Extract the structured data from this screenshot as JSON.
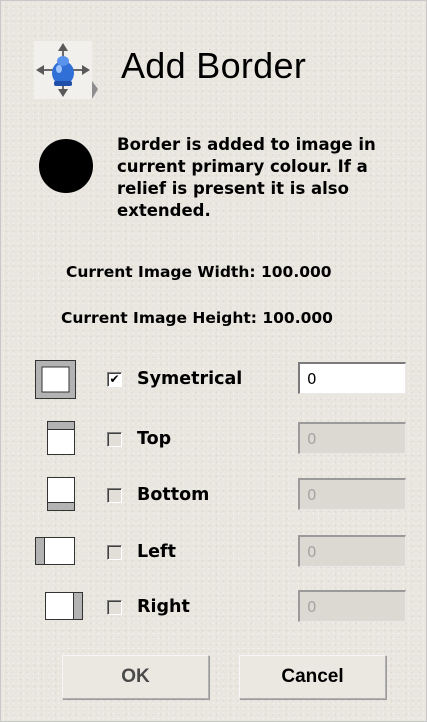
{
  "dialog": {
    "title": "Add Border",
    "app_icon": "move-arrows-icon",
    "primary_colour": "#000000",
    "description": "Border is added to image in current primary colour. If a relief is present it is also extended.",
    "width_text": "Current Image Width: 100.000",
    "height_text": "Current Image Height: 100.000"
  },
  "options": [
    {
      "label": "Symetrical",
      "checked": true,
      "value": "0",
      "enabled": true,
      "icon": "border-all-icon"
    },
    {
      "label": "Top",
      "checked": false,
      "value": "0",
      "enabled": false,
      "icon": "border-top-icon"
    },
    {
      "label": "Bottom",
      "checked": false,
      "value": "0",
      "enabled": false,
      "icon": "border-bottom-icon"
    },
    {
      "label": "Left",
      "checked": false,
      "value": "0",
      "enabled": false,
      "icon": "border-left-icon"
    },
    {
      "label": "Right",
      "checked": false,
      "value": "0",
      "enabled": false,
      "icon": "border-right-icon"
    }
  ],
  "buttons": {
    "ok": "OK",
    "cancel": "Cancel"
  },
  "check_glyph": "✔"
}
